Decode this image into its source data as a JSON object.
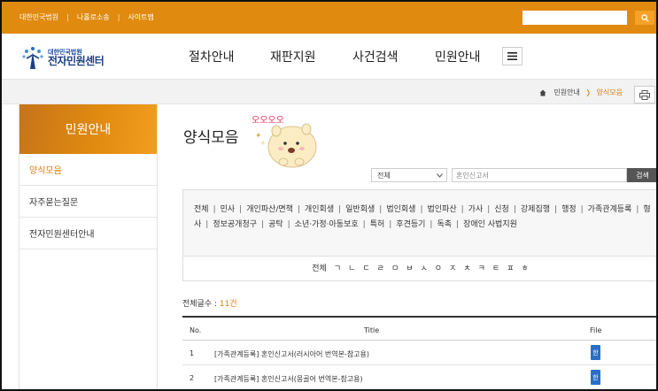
{
  "topbar": {
    "links": [
      "대한민국법원",
      "나홀로소송",
      "사이트맵"
    ],
    "search_placeholder": ""
  },
  "logo": {
    "small": "대한민국법원",
    "big": "전자민원센터"
  },
  "nav": [
    "절차안내",
    "재판지원",
    "사건검색",
    "민원안내"
  ],
  "breadcrumb": {
    "parent": "민원안내",
    "current": "양식모음"
  },
  "sidebar": {
    "title": "민원안내",
    "items": [
      "양식모음",
      "자주묻는질문",
      "전자민원센터안내"
    ]
  },
  "page": {
    "title": "양식모음",
    "mascot_text": "오오오오"
  },
  "search": {
    "select_value": "전체",
    "keyword": "혼인신고서",
    "button": "검색"
  },
  "categories": [
    "전체",
    "민사",
    "개인파산/면책",
    "개인회생",
    "일반회생",
    "법인회생",
    "법인파산",
    "가사",
    "신청",
    "강제집행",
    "행정",
    "가족관계등록",
    "형사",
    "정보공개청구",
    "공탁",
    "소년·가정·아동보호",
    "특허",
    "후견등기",
    "독촉",
    "장애인 사법지원"
  ],
  "initials": [
    "전체",
    "ㄱ",
    "ㄴ",
    "ㄷ",
    "ㄹ",
    "ㅁ",
    "ㅂ",
    "ㅅ",
    "ㅇ",
    "ㅈ",
    "ㅊ",
    "ㅋ",
    "ㅌ",
    "ㅍ",
    "ㅎ"
  ],
  "list": {
    "count_label": "전체글수 : ",
    "count": "11건",
    "headers": {
      "no": "No.",
      "title": "Title",
      "file": "File"
    },
    "rows": [
      {
        "no": "1",
        "title": "[가족관계등록] 혼인신고서(러시아어 번역본-참고용)",
        "file_icon": "hwp"
      },
      {
        "no": "2",
        "title": "[가족관계등록] 혼인신고서(몽골어 번역본-참고용)",
        "file_icon": "hwp"
      }
    ]
  },
  "colors": {
    "accent": "#e08a10",
    "accent_text": "#e07a10"
  }
}
